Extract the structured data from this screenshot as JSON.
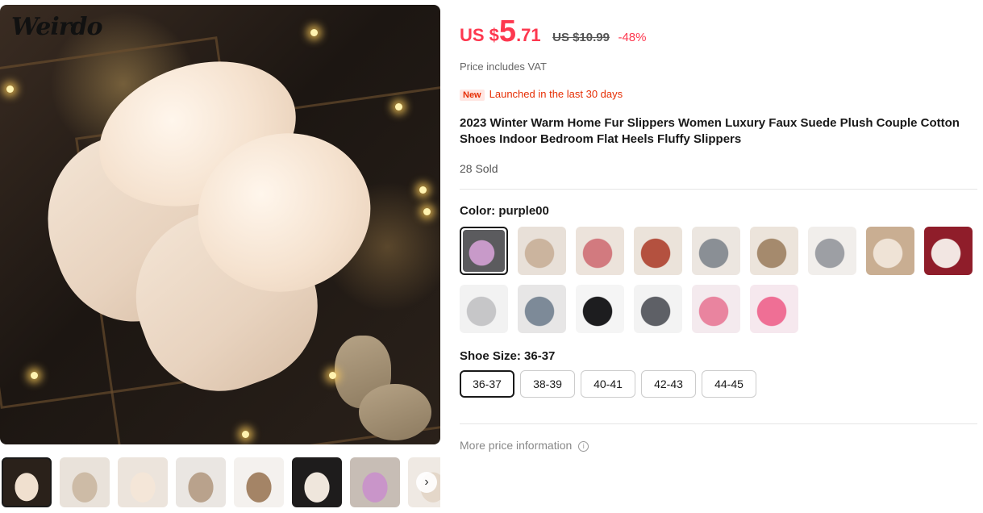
{
  "gallery": {
    "brand_logo": "Weirdo",
    "thumbnails": [
      {
        "name": "thumbnail-1",
        "color": "#2a211a",
        "accent": "#f0e0cf"
      },
      {
        "name": "thumbnail-2",
        "color": "#e9e2da",
        "accent": "#cdbba6"
      },
      {
        "name": "thumbnail-3",
        "color": "#ece4dc",
        "accent": "#f4e6d8"
      },
      {
        "name": "thumbnail-4",
        "color": "#eae6e2",
        "accent": "#b9a28c"
      },
      {
        "name": "thumbnail-5",
        "color": "#f4f1ee",
        "accent": "#a48466"
      },
      {
        "name": "thumbnail-6",
        "color": "#1e1c1c",
        "accent": "#efe6dc"
      },
      {
        "name": "thumbnail-7",
        "color": "#c7bdb5",
        "accent": "#c995c9"
      },
      {
        "name": "thumbnail-8",
        "color": "#efe9e3",
        "accent": "#e4d7c9"
      }
    ],
    "next_icon": "chevron-right-icon"
  },
  "price": {
    "prefix": "US $",
    "integer": "5",
    "decimal": ".71",
    "original": "US $10.99",
    "discount": "-48%",
    "vat_note": "Price includes VAT",
    "accent_color": "#fd384f"
  },
  "badge": {
    "label": "New",
    "text": "Launched in the last 30 days"
  },
  "product": {
    "title": "2023 Winter Warm Home Fur Slippers Women Luxury Faux Suede Plush Couple Cotton Shoes Indoor Bedroom Flat Heels Fluffy Slippers",
    "sold": "28 Sold"
  },
  "color": {
    "label": "Color: purple00",
    "selected_index": 0,
    "swatches": [
      {
        "name": "purple00",
        "base": "#5b5b5e",
        "accent": "#c89ac9"
      },
      {
        "name": "color-2",
        "base": "#e8e0d8",
        "accent": "#cbb49e"
      },
      {
        "name": "color-3",
        "base": "#ece3db",
        "accent": "#d27a7f"
      },
      {
        "name": "color-4",
        "base": "#ebe3da",
        "accent": "#b4513f"
      },
      {
        "name": "color-5",
        "base": "#ece6e0",
        "accent": "#8a8f95"
      },
      {
        "name": "color-6",
        "base": "#ece4db",
        "accent": "#a58a6d"
      },
      {
        "name": "color-7",
        "base": "#f1eeeb",
        "accent": "#9d9fa4"
      },
      {
        "name": "color-8",
        "base": "#c9ae92",
        "accent": "#efe3d6"
      },
      {
        "name": "color-9",
        "base": "#8f1d2a",
        "accent": "#f2e6e2"
      },
      {
        "name": "color-10",
        "base": "#f2f2f2",
        "accent": "#c6c6c8"
      },
      {
        "name": "color-11",
        "base": "#e7e6e6",
        "accent": "#7d8a98"
      },
      {
        "name": "color-12",
        "base": "#f5f5f5",
        "accent": "#1d1d1f"
      },
      {
        "name": "color-13",
        "base": "#f3f3f3",
        "accent": "#5e6066"
      },
      {
        "name": "color-14",
        "base": "#f4eaee",
        "accent": "#e9849f"
      },
      {
        "name": "color-15",
        "base": "#f6e8ee",
        "accent": "#ef6f95"
      }
    ]
  },
  "shoe_size": {
    "label": "Shoe Size: 36-37",
    "selected_index": 0,
    "options": [
      "36-37",
      "38-39",
      "40-41",
      "42-43",
      "44-45"
    ]
  },
  "more_price": {
    "text": "More price information",
    "icon": "info-icon"
  }
}
